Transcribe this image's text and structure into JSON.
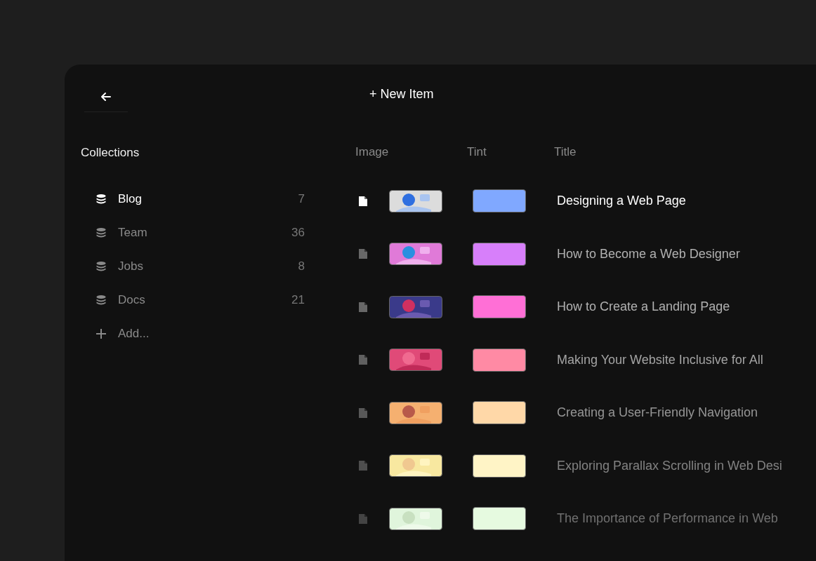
{
  "toolbar": {
    "new_item": "+ New Item"
  },
  "sidebar": {
    "heading": "Collections",
    "items": [
      {
        "kind": "collection",
        "label": "Blog",
        "count": "7",
        "selected": true
      },
      {
        "kind": "collection",
        "label": "Team",
        "count": "36",
        "selected": false
      },
      {
        "kind": "collection",
        "label": "Jobs",
        "count": "8",
        "selected": false
      },
      {
        "kind": "collection",
        "label": "Docs",
        "count": "21",
        "selected": false
      },
      {
        "kind": "add",
        "label": "Add...",
        "selected": false
      }
    ]
  },
  "table": {
    "columns": [
      "Image",
      "Tint",
      "Title"
    ],
    "rows": [
      {
        "color": "#80a8ff",
        "title": "Designing a Web Page",
        "selected": true
      },
      {
        "color": "#d77ffa",
        "title": "How to Become a Web Designer",
        "selected": false
      },
      {
        "color": "#ff6fd6",
        "title": "How to Create a Landing Page",
        "selected": false
      },
      {
        "color": "#ff8aa4",
        "title": "Making Your Website Inclusive for All",
        "selected": false
      },
      {
        "color": "#ffd8a8",
        "title": "Creating a User-Friendly Navigation",
        "selected": false
      },
      {
        "color": "#fff4c6",
        "title": "Exploring Parallax Scrolling in Web Desi",
        "selected": false
      },
      {
        "color": "#e6fae0",
        "title": "The Importance of Performance in Web",
        "selected": false
      }
    ]
  }
}
